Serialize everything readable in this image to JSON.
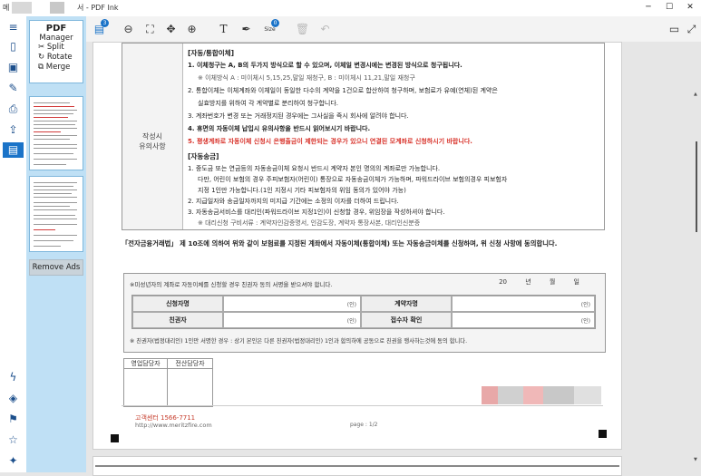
{
  "window": {
    "app_title": "PDF Ink",
    "title_prefix": "서 -",
    "title_left": "메",
    "minimize": "─",
    "maximize": "☐",
    "close": "✕"
  },
  "panel": {
    "manager_title": "PDF",
    "manager_sub": "Manager",
    "items": [
      "Split",
      "Rotate",
      "Merge"
    ],
    "remove_ads": "Remove Ads"
  },
  "toolbar": {
    "badge1": "3",
    "badge2": "0",
    "size_label": "Size"
  },
  "document": {
    "section_label_1": "작성시",
    "section_label_2": "유의사항",
    "auto_header": "[자동/통합이체]",
    "auto_lines": [
      {
        "t": "1. 이체청구는 A, B의 두가지 방식으로 할 수 있으며, 이체일 변경시에는 변경된 방식으로 청구됩니다.",
        "c": "bold"
      },
      {
        "t": "※ 이체방식 A : 미이체시 5,15,25,말일 재청구, B : 미이체시 11,21,말일 재청구",
        "c": "note"
      },
      {
        "t": "2. 통합이체는 이체계좌와 이체일이 동일한 다수의 계약을 1건으로 합산하여 청구하며, 보험료가 유예(연체)된 계약은",
        "c": ""
      },
      {
        "t": "실효방지를 위하여 각 계약별로 분리하여 청구합니다.",
        "c": "indent"
      },
      {
        "t": "3. 계좌번호가 변경 또는 거래정지된 경우에는 그사실을 즉시 회사에 알려야 합니다.",
        "c": ""
      },
      {
        "t": "4. 휴면의 자동이체 납입시 유의사항을 반드시 읽어보시기 바랍니다.",
        "c": "bold"
      },
      {
        "t": "5. 평생계좌로 자동이체 신청시 은행출금이 제한되는 경우가 있으니 연결된 모계좌로 신청하시기 바랍니다.",
        "c": "red"
      }
    ],
    "transfer_header": "[자동송금]",
    "transfer_lines": [
      {
        "t": "1. 중도금 또는 연금등의 자동송금이체 요청시 반드시 계약자 본인 명의의 계좌로만 가능합니다.",
        "c": ""
      },
      {
        "t": "다만, 어린이 보험의 경우 주피보험자(어린이) 통장으로 자동송금이체가 가능하며, 파워드라이브 보험의경우 피보험자",
        "c": "indent"
      },
      {
        "t": "지정 1인만 가능합니다.(1인 지정시 기타 피보험자의 위임 동의가 있어야 가능)",
        "c": "indent"
      },
      {
        "t": "2. 지급일자와 송금일자까지의 미지급 기간에는 소정의 이자를 더하여 드립니다.",
        "c": ""
      },
      {
        "t": "3. 자동송금서비스를 대리인(파워드라이브 지정1인)이 신청할 경우, 위임장을 작성하셔야 합니다.",
        "c": ""
      },
      {
        "t": "※ 대리신청 구비서류 : 계약자인감증명서, 인감도장, 계약자 통장사본, 대리인신분증",
        "c": "note"
      }
    ],
    "consent_para": "「전자금융거래법」 제 10조에 의하여 위와 같이 보험료를 지정된 계좌에서 자동이체(통합이체) 또는 자동송금이체를 신청하며, 위 신청 사항에 동의합니다.",
    "minor_note": "※미성년자의 계좌로 자동이체를 신청할 경우 친권자 동의 서명을 받으셔야 합니다.",
    "date_line": "20 년 월 일",
    "sig_table": {
      "applicant": "신청자명",
      "contractor": "계약자명",
      "guardian": "친권자",
      "receiver": "접수자 확인",
      "seal": "(인)"
    },
    "sig_footer": "※ 친권자(법정대리인) 1인만 서명한 경우 : 상기 본인은 다른 친권자(법정대리인) 1인과 합의하에 공동으로 친권을 행사하는것에 동의 합니다.",
    "staff_headers": [
      "영업담당자",
      "전산담당자"
    ],
    "call_center": "고객센터 1566-7711",
    "website": "http://www.meritzfire.com",
    "page_label": "page : 1/2"
  },
  "colors": {
    "accent": "#1a73c8",
    "panel_bg": "#bfe0f5",
    "red_text": "#d8322a"
  }
}
